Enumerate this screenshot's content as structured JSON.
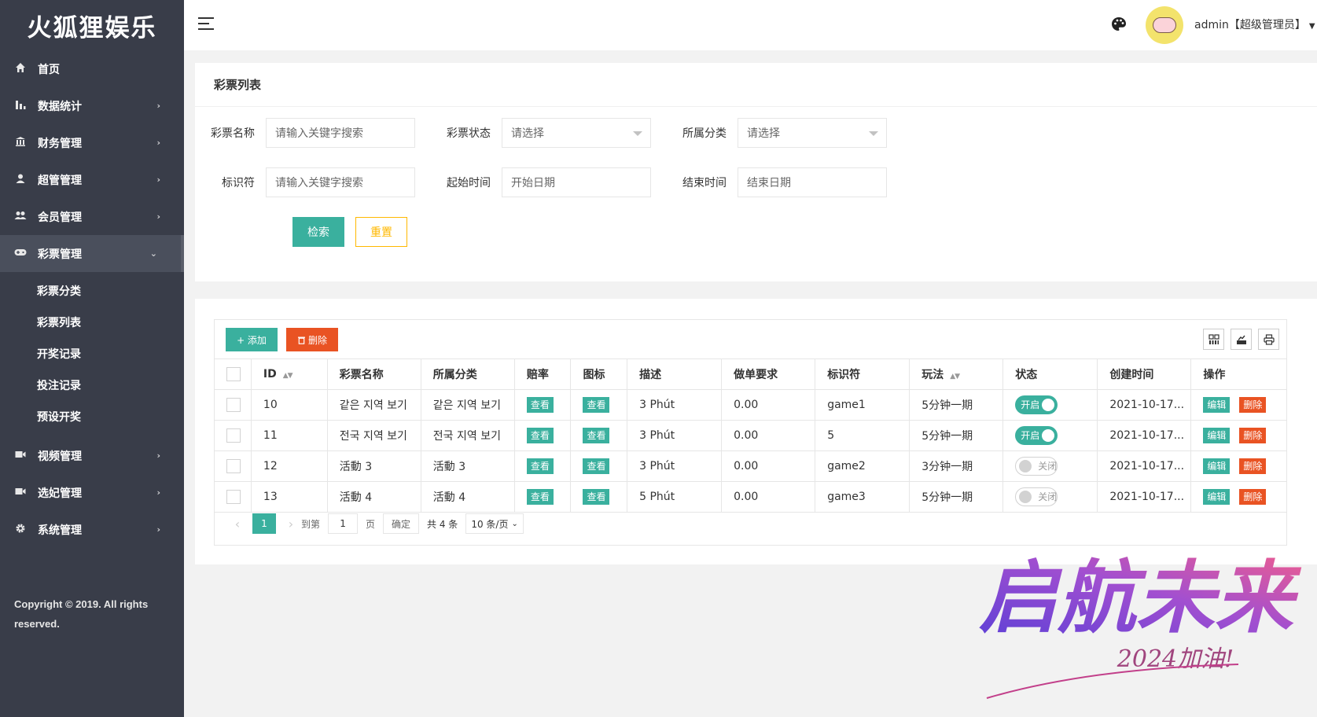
{
  "brand": "火狐狸娱乐",
  "sidebar": {
    "items": [
      {
        "label": "首页",
        "icon": "home-icon"
      },
      {
        "label": "数据统计",
        "icon": "chart-icon"
      },
      {
        "label": "财务管理",
        "icon": "bank-icon"
      },
      {
        "label": "超管管理",
        "icon": "user-icon"
      },
      {
        "label": "会员管理",
        "icon": "users-icon"
      },
      {
        "label": "彩票管理",
        "icon": "gamepad-icon"
      }
    ],
    "subitems": [
      "彩票分类",
      "彩票列表",
      "开奖记录",
      "投注记录",
      "预设开奖"
    ],
    "items_bottom": [
      {
        "label": "视频管理",
        "icon": "video-icon"
      },
      {
        "label": "选妃管理",
        "icon": "video-icon"
      },
      {
        "label": "系统管理",
        "icon": "gear-icon"
      }
    ],
    "copyright": "Copyright © 2019. All rights reserved."
  },
  "header": {
    "user": "admin【超级管理员】"
  },
  "search_card": {
    "title": "彩票列表",
    "fields": {
      "name_label": "彩票名称",
      "name_placeholder": "请输入关键字搜索",
      "status_label": "彩票状态",
      "status_value": "请选择",
      "category_label": "所属分类",
      "category_value": "请选择",
      "key_label": "标识符",
      "key_placeholder": "请输入关键字搜索",
      "start_label": "起始时间",
      "start_placeholder": "开始日期",
      "end_label": "结束时间",
      "end_placeholder": "结束日期"
    },
    "search_label": "检索",
    "reset_label": "重置"
  },
  "table": {
    "add_label": "+ 添加",
    "delete_label": "删除",
    "columns": [
      "ID",
      "彩票名称",
      "所属分类",
      "赔率",
      "图标",
      "描述",
      "做单要求",
      "标识符",
      "玩法",
      "状态",
      "创建时间",
      "操作"
    ],
    "view_label": "查看",
    "edit_label": "编辑",
    "del_label": "删除",
    "rows": [
      {
        "id": "10",
        "name": "같은 지역 보기",
        "category": "같은 지역 보기",
        "desc": "3 Phút",
        "req": "0.00",
        "key": "game1",
        "play": "5分钟一期",
        "status": "开启",
        "on": true,
        "created": "2021-10-17..."
      },
      {
        "id": "11",
        "name": "전국 지역 보기",
        "category": "전국 지역 보기",
        "desc": "3 Phút",
        "req": "0.00",
        "key": "5",
        "play": "5分钟一期",
        "status": "开启",
        "on": true,
        "created": "2021-10-17..."
      },
      {
        "id": "12",
        "name": "活動 3",
        "category": "活動 3",
        "desc": "3 Phút",
        "req": "0.00",
        "key": "game2",
        "play": "3分钟一期",
        "status": "关闭",
        "on": false,
        "created": "2021-10-17..."
      },
      {
        "id": "13",
        "name": "活動 4",
        "category": "活動 4",
        "desc": "5 Phút",
        "req": "0.00",
        "key": "game3",
        "play": "5分钟一期",
        "status": "关闭",
        "on": false,
        "created": "2021-10-17..."
      }
    ]
  },
  "pager": {
    "current": "1",
    "goto_label": "到第",
    "goto_value": "1",
    "page_label": "页",
    "confirm_label": "确定",
    "total": "共 4 条",
    "per_page": "10 条/页"
  },
  "watermark": {
    "main": "启航未来",
    "sub": "2024加油!"
  },
  "colors": {
    "sidebar": "#393d49",
    "accent": "#3ab09e",
    "danger": "#e95323",
    "warn": "#ffb800"
  }
}
